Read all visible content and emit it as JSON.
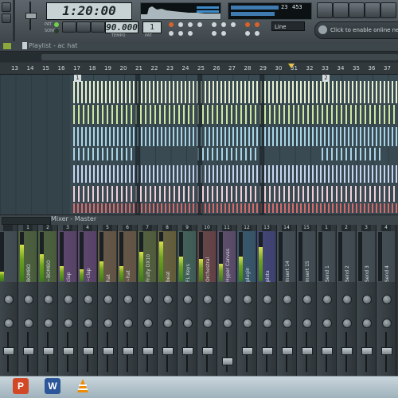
{
  "toolbar": {
    "time": "1:20:00",
    "tempo": "90.000",
    "tempo_label": "TEMPO",
    "pattern": "1",
    "pattern_label": "PAT",
    "cpu_value": "23",
    "cpu_extra": "453",
    "mode_pat": "PAT",
    "mode_song": "SONG",
    "snap": "Line",
    "online_text": "Click to enable online news"
  },
  "playlist": {
    "title": "Playlist - ac hat",
    "ruler_numbers": [
      "13",
      "14",
      "15",
      "16",
      "17",
      "18",
      "19",
      "20",
      "21",
      "22",
      "23",
      "24",
      "25",
      "26",
      "27",
      "28",
      "29",
      "30",
      "31",
      "32",
      "33",
      "34",
      "35",
      "36",
      "37"
    ],
    "pattern_markers": [
      "1",
      "2"
    ]
  },
  "mixer": {
    "title": "Mixer - Master",
    "channels": [
      {
        "num": "",
        "name": "",
        "color": "#4d5a60"
      },
      {
        "num": "1",
        "name": "BOMBO",
        "color": "#5c7a3a"
      },
      {
        "num": "2",
        "name": "~BOMBO",
        "color": "#5c7a3a"
      },
      {
        "num": "3",
        "name": "clap",
        "color": "#7a4a8a"
      },
      {
        "num": "4",
        "name": "~clap",
        "color": "#7a4a8a"
      },
      {
        "num": "5",
        "name": "hat",
        "color": "#8a6a4a"
      },
      {
        "num": "6",
        "name": "~hat",
        "color": "#8a6a4a"
      },
      {
        "num": "7",
        "name": "Fruity DX10",
        "color": "#6a7a3a"
      },
      {
        "num": "8",
        "name": "beat",
        "color": "#8a7a3a"
      },
      {
        "num": "9",
        "name": "FL Keys",
        "color": "#4a7a6a"
      },
      {
        "num": "10",
        "name": "Orchestral",
        "color": "#8a4a4a"
      },
      {
        "num": "11",
        "name": "Hyper Canvas",
        "color": "#7a5a8a"
      },
      {
        "num": "12",
        "name": "plugin",
        "color": "#3a6a8a"
      },
      {
        "num": "13",
        "name": "pista",
        "color": "#4a4a9a"
      },
      {
        "num": "14",
        "name": "Insert 14",
        "color": "#4d5a60"
      },
      {
        "num": "15",
        "name": "Insert 15",
        "color": "#4d5a60"
      },
      {
        "num": "1",
        "name": "Send 1",
        "color": "#4d5a60"
      },
      {
        "num": "2",
        "name": "Send 2",
        "color": "#4d5a60"
      },
      {
        "num": "3",
        "name": "Send 3",
        "color": "#4d5a60"
      },
      {
        "num": "4",
        "name": "Send 4",
        "color": "#4d5a60"
      }
    ],
    "meter_levels": [
      0.2,
      0.75,
      0.55,
      0.3,
      0.25,
      0.4,
      0.3,
      0.6,
      0.8,
      0.5,
      0.45,
      0.35,
      0.5,
      0.7,
      0.0,
      0.0,
      0.0,
      0.0,
      0.0,
      0.0
    ],
    "fader_levels": [
      0.55,
      0.55,
      0.55,
      0.55,
      0.55,
      0.55,
      0.55,
      0.55,
      0.55,
      0.55,
      0.55,
      0.25,
      0.55,
      0.55,
      0.55,
      0.55,
      0.55,
      0.55,
      0.55,
      0.55
    ]
  },
  "taskbar": {
    "icons": [
      "powerpoint-icon",
      "word-icon",
      "vlc-icon"
    ],
    "ppt_letter": "P",
    "word_letter": "W"
  }
}
